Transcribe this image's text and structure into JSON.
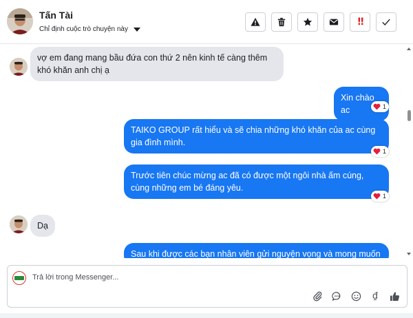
{
  "header": {
    "contact_name": "Tấn Tài",
    "assign_label": "Chỉ định cuộc trò chuyện này",
    "actions": [
      {
        "name": "warning-button",
        "icon": "warning-icon"
      },
      {
        "name": "delete-button",
        "icon": "trash-icon"
      },
      {
        "name": "star-button",
        "icon": "star-icon"
      },
      {
        "name": "mail-button",
        "icon": "envelope-icon"
      },
      {
        "name": "urgent-button",
        "icon": "double-exclamation-icon",
        "label": "!!"
      },
      {
        "name": "done-button",
        "icon": "checkmark-icon"
      }
    ]
  },
  "messages": [
    {
      "from": "contact",
      "text": "vợ em đang mang bầu đứa con thứ 2 nên kinh tế càng thêm khó khăn anh chị ạ"
    },
    {
      "from": "page",
      "text": "Xin chào ac",
      "reaction": {
        "emoji": "heart",
        "count": "1"
      }
    },
    {
      "from": "page",
      "text": "TAIKO GROUP rất hiểu và sẽ chia những khó khăn của ac cùng gia đình mình.",
      "reaction": {
        "emoji": "heart",
        "count": "1"
      }
    },
    {
      "from": "page",
      "text": "Trước tiên chúc mừng ac đã có được một ngôi nhà ấm cúng, cùng những em bé đáng yêu.",
      "reaction": {
        "emoji": "heart",
        "count": "1"
      }
    },
    {
      "from": "contact",
      "text": "Dạ"
    },
    {
      "from": "page",
      "text": "Sau khi được các bạn nhân viên gửi nguyện vọng và mong muốn"
    }
  ],
  "composer": {
    "placeholder": "Trả lời trong Messenger...",
    "tools": [
      "paperclip-icon",
      "chat-bubble-icon",
      "emoji-icon",
      "currency-icon",
      "thumbs-up-icon"
    ],
    "currency_symbol": "₫"
  },
  "colors": {
    "outgoing": "#1877f2",
    "incoming": "#e4e6eb",
    "heart": "#e41e3f",
    "alert": "#e02020"
  }
}
